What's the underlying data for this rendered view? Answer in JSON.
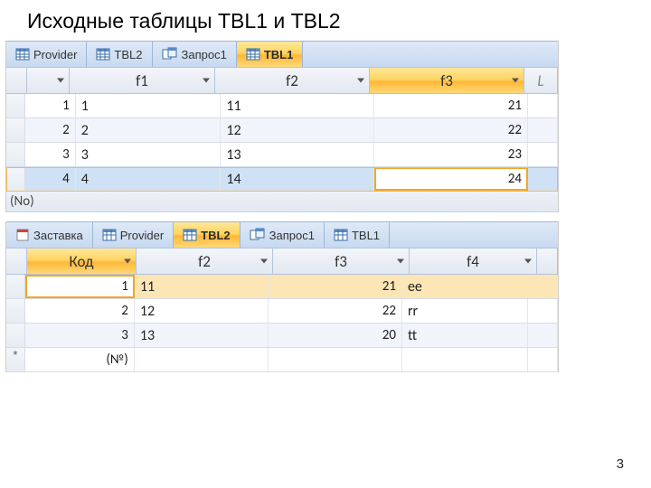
{
  "title": "Исходные таблицы TBL1 и TBL2",
  "page_number": "3",
  "tbl1": {
    "tabs": [
      {
        "label": "Provider",
        "kind": "table",
        "active": false
      },
      {
        "label": "TBL2",
        "kind": "table",
        "active": false
      },
      {
        "label": "Запрос1",
        "kind": "query",
        "active": false
      },
      {
        "label": "TBL1",
        "kind": "table",
        "active": true
      }
    ],
    "cols": {
      "f1": "f1",
      "f2": "f2",
      "f3": "f3",
      "last": "L"
    },
    "rows": [
      {
        "id": "1",
        "f1": "1",
        "f2": "11",
        "f3": "21"
      },
      {
        "id": "2",
        "f1": "2",
        "f2": "12",
        "f3": "22"
      },
      {
        "id": "3",
        "f1": "3",
        "f2": "13",
        "f3": "23"
      },
      {
        "id": "4",
        "f1": "4",
        "f2": "14",
        "f3": "24"
      }
    ],
    "norec": "(No)"
  },
  "tbl2": {
    "tabs": [
      {
        "label": "Заставка",
        "kind": "form",
        "active": false
      },
      {
        "label": "Provider",
        "kind": "table",
        "active": false
      },
      {
        "label": "TBL2",
        "kind": "table",
        "active": true
      },
      {
        "label": "Запрос1",
        "kind": "query",
        "active": false
      },
      {
        "label": "TBL1",
        "kind": "table",
        "active": false
      }
    ],
    "cols": {
      "kod": "Код",
      "f2": "f2",
      "f3": "f3",
      "f4": "f4"
    },
    "rows": [
      {
        "kod": "1",
        "f2": "11",
        "f3": "21",
        "f4": "ee"
      },
      {
        "kod": "2",
        "f2": "12",
        "f3": "22",
        "f4": "rr"
      },
      {
        "kod": "3",
        "f2": "13",
        "f3": "20",
        "f4": "tt"
      }
    ],
    "newlabel": "(№)"
  }
}
